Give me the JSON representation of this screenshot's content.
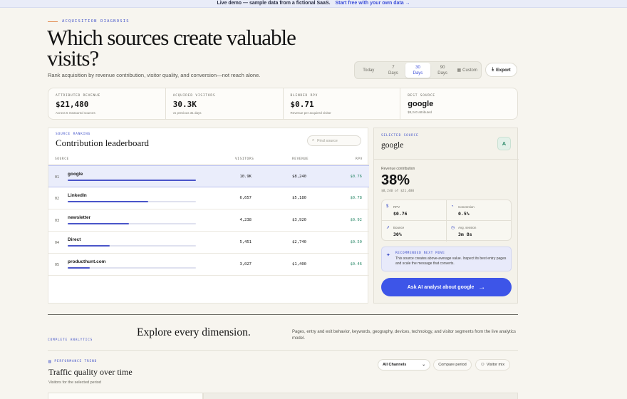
{
  "banner": {
    "message": "Live demo — sample data from a fictional SaaS.",
    "cta": "Start free with your own data →"
  },
  "hero": {
    "eyebrow": "ACQUISITION DIAGNOSIS",
    "title": "Which sources create valuable visits?",
    "subtitle": "Rank acquisition by revenue contribution, visitor quality, and conversion—not reach alone."
  },
  "range": {
    "options": [
      {
        "l1": "Today",
        "l2": ""
      },
      {
        "l1": "7",
        "l2": "Days"
      },
      {
        "l1": "30",
        "l2": "Days"
      },
      {
        "l1": "90",
        "l2": "Days"
      },
      {
        "l1": "Custom",
        "l2": ""
      }
    ],
    "active_index": 2,
    "export_label": "Export"
  },
  "kpis": [
    {
      "label": "ATTRIBUTED REVENUE",
      "value": "$21,480",
      "note": "Across 5 measured sources"
    },
    {
      "label": "ACQUIRED VISITORS",
      "value": "30.3K",
      "note": "vs previous 31 days"
    },
    {
      "label": "BLENDED RPV",
      "value": "$0.71",
      "note": "Revenue per acquired visitor"
    },
    {
      "label": "BEST SOURCE",
      "value": "google",
      "note": "$8,240 attributed"
    }
  ],
  "leaderboard": {
    "tag": "SOURCE RANKING",
    "title": "Contribution leaderboard",
    "search_placeholder": "Find source",
    "columns": {
      "source": "SOURCE",
      "visitors": "VISITORS",
      "revenue": "REVENUE",
      "rpv": "RPV"
    },
    "rows": [
      {
        "rank": "01",
        "name": "google",
        "visitors": "10.9K",
        "revenue": "$8,240",
        "rpv": "$0.76",
        "share": 1.0
      },
      {
        "rank": "02",
        "name": "LinkedIn",
        "visitors": "6,657",
        "revenue": "$5,180",
        "rpv": "$0.78",
        "share": 0.63
      },
      {
        "rank": "03",
        "name": "newsletter",
        "visitors": "4,238",
        "revenue": "$3,920",
        "rpv": "$0.92",
        "share": 0.48
      },
      {
        "rank": "04",
        "name": "Direct",
        "visitors": "5,451",
        "revenue": "$2,740",
        "rpv": "$0.50",
        "share": 0.33
      },
      {
        "rank": "05",
        "name": "producthunt.com",
        "visitors": "3,027",
        "revenue": "$1,400",
        "rpv": "$0.46",
        "share": 0.17
      }
    ],
    "selected_index": 0
  },
  "detail": {
    "tag": "SELECTED SOURCE",
    "source": "google",
    "badge": "A",
    "contribution_label": "Revenue contribution",
    "contribution_value": "38%",
    "contribution_note": "$8,240 of $21,480",
    "metrics": [
      {
        "icon": "$",
        "label": "RPV",
        "value": "$0.76"
      },
      {
        "icon": "◔",
        "label": "Conversion",
        "value": "0.5%"
      },
      {
        "icon": "➚",
        "label": "Bounce",
        "value": "30%"
      },
      {
        "icon": "◷",
        "label": "Avg. session",
        "value": "3m 8s"
      }
    ],
    "recommendation_tag": "RECOMMENDED NEXT MOVE",
    "recommendation": "This source creates above-average value. Inspect its best entry pages and scale the message that converts.",
    "ask_label": "Ask AI analyst about google"
  },
  "analytics": {
    "tag": "COMPLETE ANALYTICS",
    "title": "Explore every dimension.",
    "description": "Pages, entry and exit behavior, keywords, geography, devices, technology, and visitor segments from the live analytics model."
  },
  "performance": {
    "tag": "PERFORMANCE TREND",
    "title": "Traffic quality over time",
    "subtitle": "Visitors for the selected period",
    "channel_select": "All Channels",
    "compare_label": "Compare period",
    "visitor_mix_label": "Visitor mix"
  },
  "colors": {
    "accent": "#3d55e8",
    "positive": "#2d8a6a",
    "bar": "#4a55c9",
    "eyebrow_rule": "#e2894e"
  },
  "icons": {
    "search": "search-icon",
    "export": "download-icon",
    "custom": "calendar-icon",
    "ask_arrow": "arrow-right-icon",
    "rec": "sparkle-icon"
  }
}
